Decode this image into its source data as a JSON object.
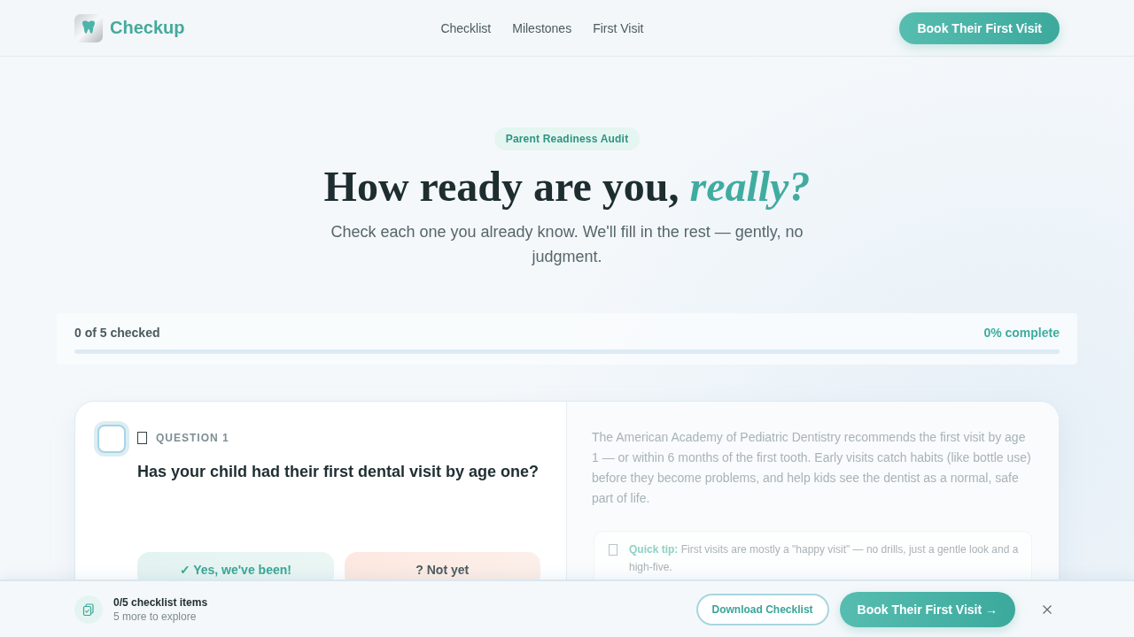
{
  "header": {
    "logo_text": "Checkup",
    "nav": [
      "Checklist",
      "Milestones",
      "First Visit"
    ],
    "cta": "Book Their First Visit"
  },
  "hero": {
    "badge": "Parent Readiness Audit",
    "title": "How ready are you, *really?*",
    "subtitle": "Check each one you already know. We'll fill in the rest — gently, no judgment."
  },
  "progress": {
    "count_label": "0 of 5 checked",
    "percent_label": "0% complete",
    "level": 0
  },
  "question_card": {
    "checked": false,
    "label": "QUESTION 1",
    "question": "Has your child had their first dental visit by age one?",
    "answers": [
      {
        "label": "✓ Yes, we've been!",
        "kind": "yes"
      },
      {
        "label": "? Not yet",
        "kind": "no"
      }
    ],
    "explanation": "The American Academy of Pediatric Dentistry recommends the first visit by age 1 — or within 6 months of the first tooth. Early visits catch habits (like bottle use) before they become problems, and help kids see the dentist as a normal, safe part of life.",
    "tip": "**Quick tip:** First visits are mostly a \"happy visit\" — no drills, just a gentle look and a high-five."
  },
  "bottom_bar": {
    "title": "0/5 checklist items",
    "subtitle": "5 more to explore",
    "buttons": [
      {
        "label": "Download Checklist",
        "kind": "outline"
      },
      {
        "label": "Book Their First Visit →",
        "kind": "primary"
      }
    ]
  }
}
